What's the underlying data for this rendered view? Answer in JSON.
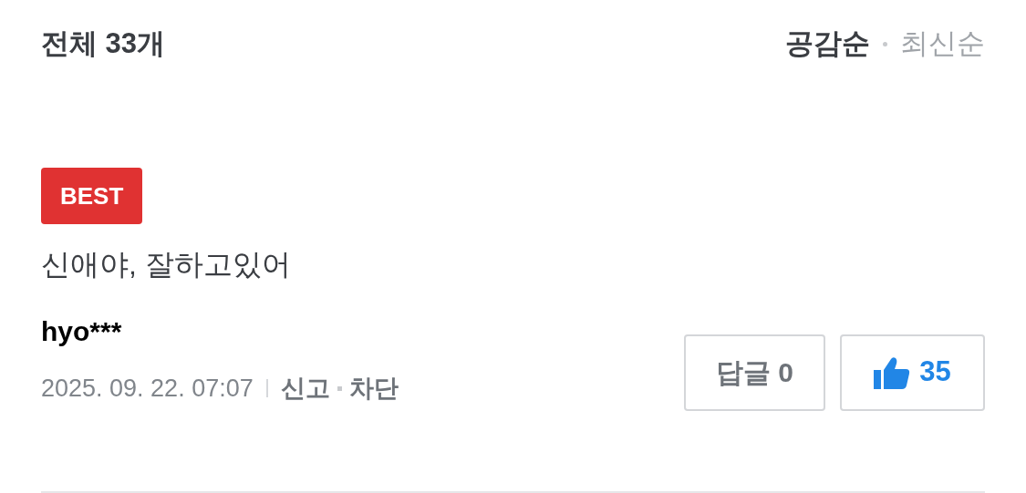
{
  "header": {
    "title": "전체 33개"
  },
  "sort_options": [
    {
      "label": "공감순",
      "selected": true
    },
    {
      "label": "최신순",
      "selected": false
    }
  ],
  "comments": [
    {
      "badge": "BEST",
      "text": "신애야, 잘하고있어",
      "author": "hyo***",
      "date": "2025. 09. 22. 07:07",
      "actions": [
        "신고",
        "차단"
      ],
      "reply_button": "답글 0",
      "likes": "35"
    }
  ]
}
